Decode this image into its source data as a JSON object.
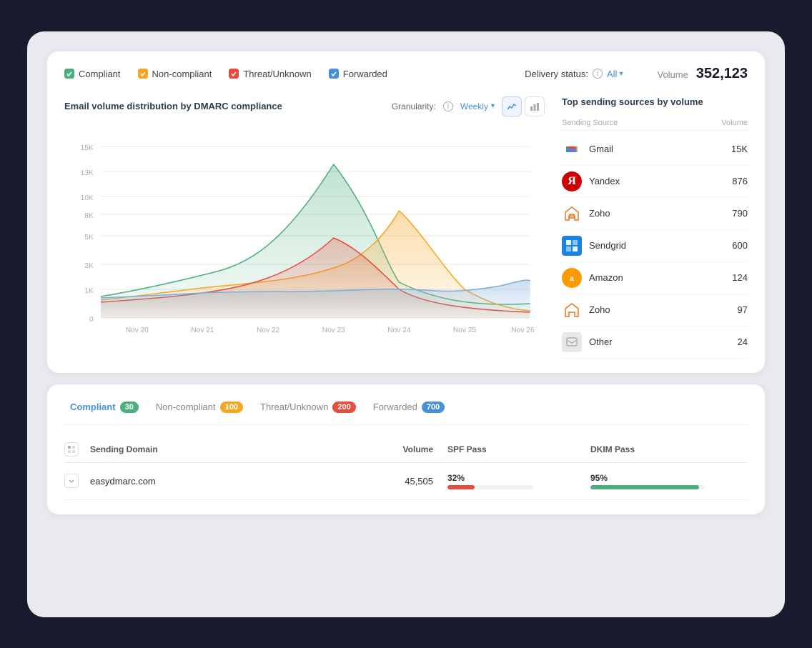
{
  "filter": {
    "compliant_label": "Compliant",
    "non_compliant_label": "Non-compliant",
    "threat_label": "Threat/Unknown",
    "forwarded_label": "Forwarded",
    "delivery_label": "Delivery status:",
    "delivery_value": "All",
    "volume_label": "Volume",
    "volume_number": "352,123"
  },
  "chart": {
    "title": "Email volume distribution by DMARC compliance",
    "granularity_label": "Granularity:",
    "granularity_value": "Weekly",
    "x_labels": [
      "Nov 20",
      "Nov 21",
      "Nov 22",
      "Nov 23",
      "Nov 24",
      "Nov 25",
      "Nov 26"
    ],
    "y_labels": [
      "0",
      "1K",
      "2K",
      "5K",
      "8K",
      "10K",
      "13K",
      "15K"
    ]
  },
  "sources": {
    "title": "Top sending sources by volume",
    "header_source": "Sending Source",
    "header_volume": "Volume",
    "rows": [
      {
        "name": "Gmail",
        "volume": "15K",
        "icon_type": "google"
      },
      {
        "name": "Yandex",
        "volume": "876",
        "icon_type": "yandex"
      },
      {
        "name": "Zoho",
        "volume": "790",
        "icon_type": "zoho"
      },
      {
        "name": "Sendgrid",
        "volume": "600",
        "icon_type": "sendgrid"
      },
      {
        "name": "Amazon",
        "volume": "124",
        "icon_type": "amazon"
      },
      {
        "name": "Zoho",
        "volume": "97",
        "icon_type": "zoho"
      },
      {
        "name": "Other",
        "volume": "24",
        "icon_type": "other"
      }
    ]
  },
  "tabs": [
    {
      "label": "Compliant",
      "badge": "30",
      "badge_class": "badge-green",
      "active": true
    },
    {
      "label": "Non-compliant",
      "badge": "100",
      "badge_class": "badge-orange",
      "active": false
    },
    {
      "label": "Threat/Unknown",
      "badge": "200",
      "badge_class": "badge-red",
      "active": false
    },
    {
      "label": "Forwarded",
      "badge": "700",
      "badge_class": "badge-blue",
      "active": false
    }
  ],
  "table": {
    "col_icon": "",
    "col_domain": "Sending Domain",
    "col_volume": "Volume",
    "col_spf": "SPF Pass",
    "col_dkim": "DKIM Pass",
    "rows": [
      {
        "domain": "easydmarc.com",
        "volume": "45,505",
        "spf_pct": "32%",
        "spf_fill_width": 32,
        "spf_color": "fill-red",
        "dkim_pct": "95%",
        "dkim_fill_width": 95,
        "dkim_color": "fill-green"
      }
    ]
  }
}
